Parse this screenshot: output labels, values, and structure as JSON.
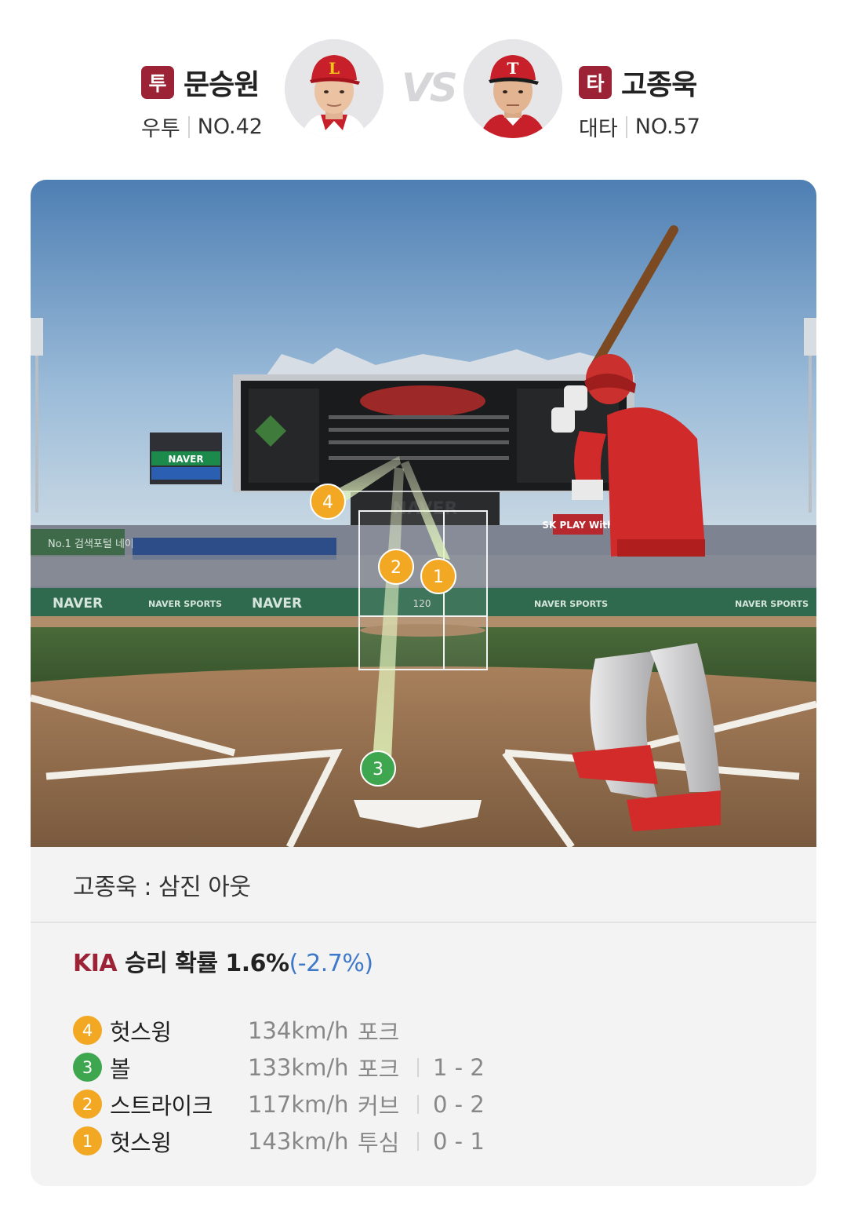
{
  "pitcher": {
    "role": "투",
    "name": "문승원",
    "hand": "우투",
    "number": "NO.42",
    "cap_letter": "L",
    "cap_color": "#c8202a"
  },
  "vs": "VS",
  "batter": {
    "role": "타",
    "name": "고종욱",
    "hand": "대타",
    "number": "NO.57",
    "cap_letter": "T",
    "cap_color": "#c8202a"
  },
  "field": {
    "scoreboard_brand": "NAVER",
    "wall_ads": [
      "NAVER",
      "NAVER SPORTS",
      "NAVER",
      "NAVER SPORTS",
      "NAVER SPORTS"
    ],
    "stand_banner": "No.1 검색포털 네이버",
    "sponsor_sign": "SK PLAY With",
    "zone_label": "120",
    "markers": [
      {
        "num": "4",
        "color": "#f2a823"
      },
      {
        "num": "2",
        "color": "#f2a823"
      },
      {
        "num": "1",
        "color": "#f2a823"
      },
      {
        "num": "3",
        "color": "#3fa650"
      }
    ]
  },
  "result": "고종욱 : 삼진 아웃",
  "win_probability": {
    "team": "KIA",
    "label": " 승리 확률 1.6%",
    "delta": "(-2.7%)"
  },
  "pitches": [
    {
      "num": "4",
      "color": "#f2a823",
      "result": "헛스윙",
      "speed": "134km/h",
      "type": "포크",
      "count": ""
    },
    {
      "num": "3",
      "color": "#3fa650",
      "result": "볼",
      "speed": "133km/h",
      "type": "포크",
      "count": "1 - 2"
    },
    {
      "num": "2",
      "color": "#f2a823",
      "result": "스트라이크",
      "speed": "117km/h",
      "type": "커브",
      "count": "0 - 2"
    },
    {
      "num": "1",
      "color": "#f2a823",
      "result": "헛스윙",
      "speed": "143km/h",
      "type": "투심",
      "count": "0 - 1"
    }
  ]
}
